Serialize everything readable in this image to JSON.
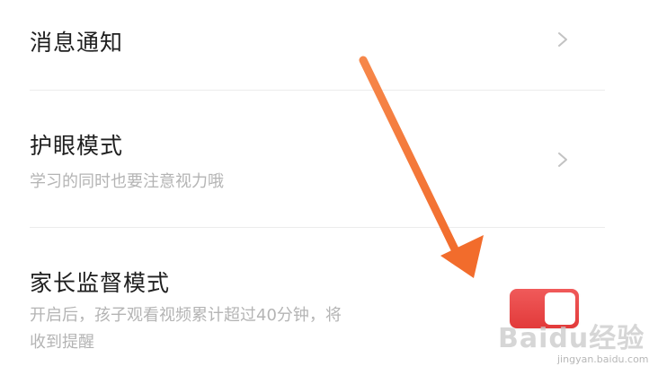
{
  "settings": {
    "items": [
      {
        "title": "消息通知",
        "has_chevron": true
      },
      {
        "title": "护眼模式",
        "description": "学习的同时也要注意视力哦",
        "has_chevron": true
      },
      {
        "title": "家长监督模式",
        "description_line1": "开启后，孩子观看视频累计超过40分钟，将",
        "description_line2": "收到提醒",
        "toggle_on": true
      }
    ]
  },
  "watermark": {
    "brand": "Baidu经验",
    "url": "jingyan.baidu.com"
  },
  "colors": {
    "toggle_on": "#e8474a",
    "arrow": "#f47a3c",
    "title_text": "#1f1f1f",
    "description_text": "#b4b4b4",
    "divider": "#ececec"
  }
}
